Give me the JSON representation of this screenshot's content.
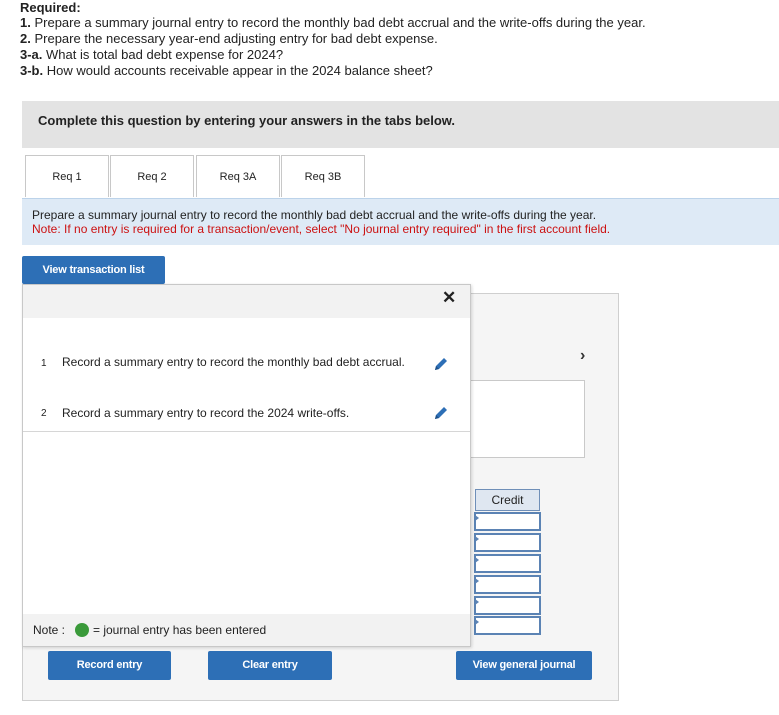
{
  "required": {
    "heading": "Required:",
    "items": [
      {
        "num": "1.",
        "text": "Prepare a summary journal entry to record the monthly bad debt accrual and the write-offs during the year."
      },
      {
        "num": "2.",
        "text": "Prepare the necessary year-end adjusting entry for bad debt expense."
      },
      {
        "num": "3-a.",
        "text": "What is total bad debt expense for 2024?"
      },
      {
        "num": "3-b.",
        "text": "How would accounts receivable appear in the 2024 balance sheet?"
      }
    ]
  },
  "instruction_bar": "Complete this question by entering your answers in the tabs below.",
  "tabs": [
    {
      "label": "Req 1"
    },
    {
      "label": "Req 2"
    },
    {
      "label": "Req 3A"
    },
    {
      "label": "Req 3B"
    }
  ],
  "info": {
    "prompt": "Prepare a summary journal entry to record the monthly bad debt accrual and the write-offs during the year.",
    "note": "Note: If no entry is required for a transaction/event, select \"No journal entry required\" in the first account field."
  },
  "view_transaction_list_label": "View transaction list",
  "close_symbol": "✕",
  "transactions": [
    {
      "num": "1",
      "text": "Record a summary entry to record the monthly bad debt accrual."
    },
    {
      "num": "2",
      "text": "Record a summary entry to record the 2024 write-offs."
    }
  ],
  "note_legend": {
    "label": "Note :",
    "text": "= journal entry has been entered",
    "dot_color": "#3a9a3a"
  },
  "journal": {
    "next_symbol": "›",
    "credit_header": "Credit",
    "credit_rows": 6
  },
  "buttons": {
    "record_entry": "Record entry",
    "clear_entry": "Clear entry",
    "view_general_journal": "View general journal"
  },
  "colors": {
    "button_blue": "#2d6fb6",
    "note_red": "#cc1111",
    "info_bg": "#deeaf6"
  }
}
